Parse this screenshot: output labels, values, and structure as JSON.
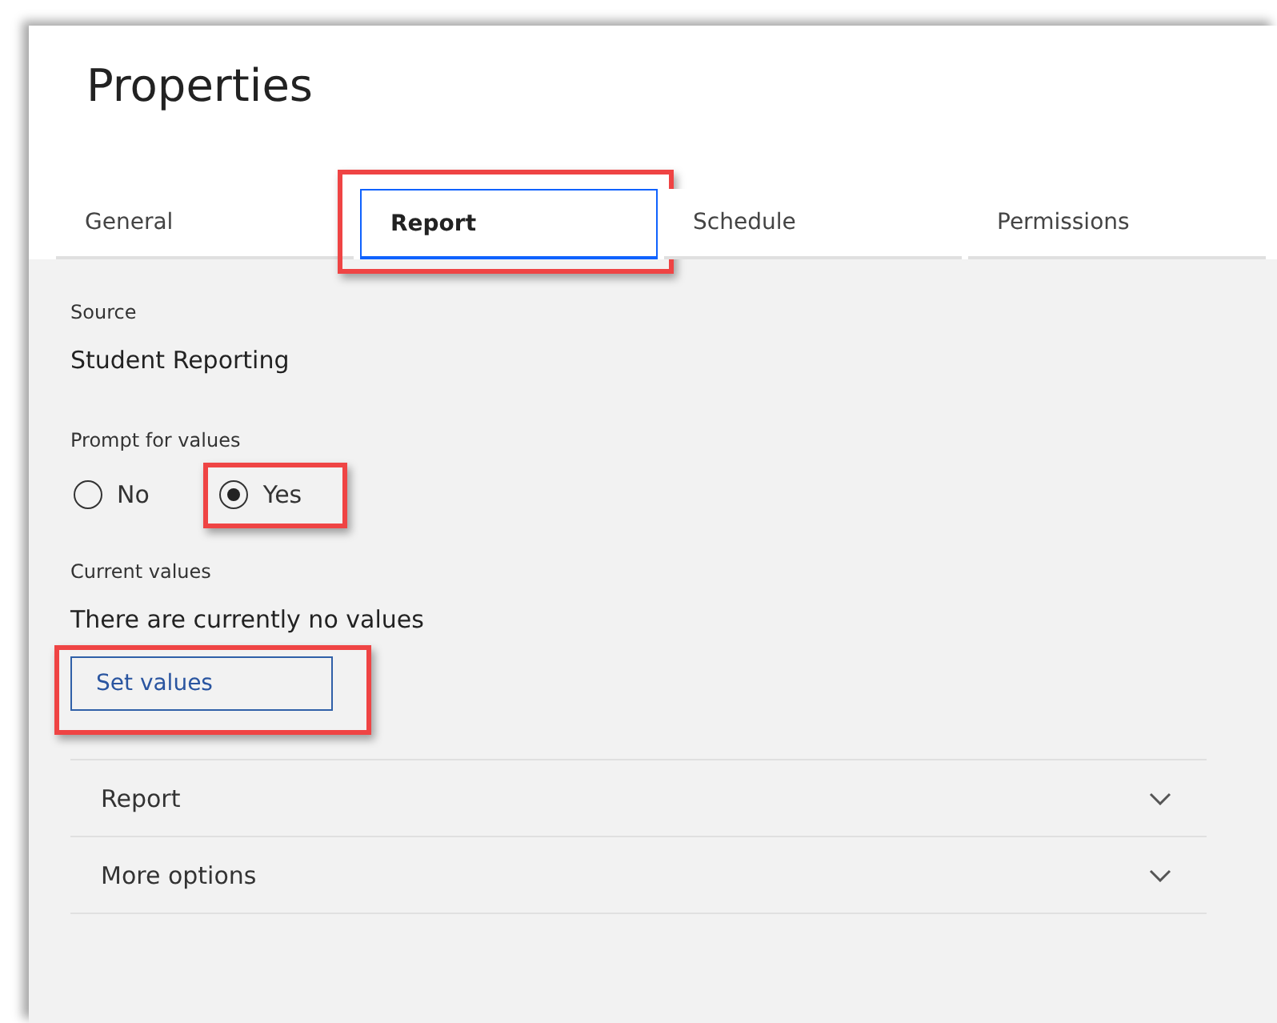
{
  "title": "Properties",
  "tabs": [
    {
      "label": "General",
      "selected": false,
      "highlighted": false
    },
    {
      "label": "Report",
      "selected": true,
      "highlighted": true
    },
    {
      "label": "Schedule",
      "selected": false,
      "highlighted": false
    },
    {
      "label": "Permissions",
      "selected": false,
      "highlighted": false
    }
  ],
  "source": {
    "label": "Source",
    "value": "Student Reporting"
  },
  "prompt": {
    "label": "Prompt for values",
    "options": [
      {
        "label": "No",
        "selected": false,
        "highlighted": false
      },
      {
        "label": "Yes",
        "selected": true,
        "highlighted": true
      }
    ]
  },
  "current_values": {
    "label": "Current values",
    "text": "There are currently no values",
    "button": {
      "label": "Set values",
      "highlighted": true
    }
  },
  "sections": [
    {
      "label": "Report",
      "expanded": false
    },
    {
      "label": "More options",
      "expanded": false
    }
  ]
}
